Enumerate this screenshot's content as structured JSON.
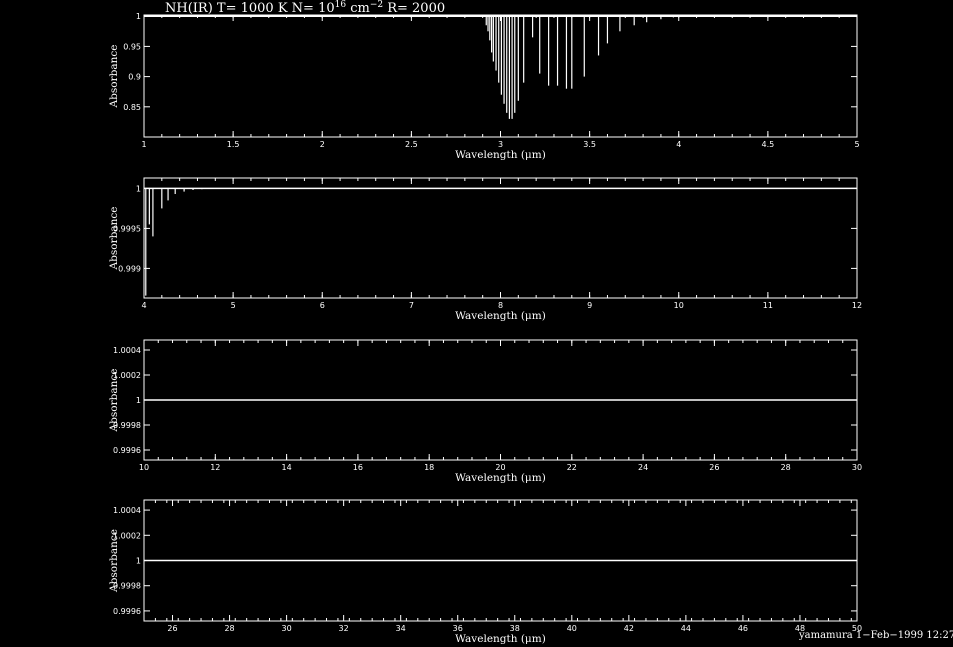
{
  "title": {
    "prefix": "NH(IR) T= 1000 K N= 10",
    "exponent1": "16",
    "middle": " cm",
    "exponent2": "−2",
    "suffix": " R= 2000"
  },
  "credit": "yamamura  1−Feb−1999 12:27",
  "colors": {
    "background": "#000000",
    "foreground": "#ffffff"
  },
  "chart_data": [
    {
      "type": "line",
      "xlabel": "Wavelength (μm)",
      "ylabel": "Absorbance",
      "xlim": [
        1,
        5
      ],
      "ylim": [
        0.8,
        1.002
      ],
      "xticks": [
        1,
        1.5,
        2,
        2.5,
        3,
        3.5,
        4,
        4.5,
        5
      ],
      "xtick_labels": [
        "1",
        "1.5",
        "2",
        "2.5",
        "3",
        "3.5",
        "4",
        "4.5",
        "5"
      ],
      "yticks": [
        0.85,
        0.9,
        0.95,
        1
      ],
      "ytick_labels": [
        "0.85",
        "0.9",
        "0.95",
        "1"
      ],
      "baseline": 1,
      "lines": [
        [
          2.92,
          0.985
        ],
        [
          2.93,
          0.975
        ],
        [
          2.94,
          0.96
        ],
        [
          2.95,
          0.94
        ],
        [
          2.96,
          0.925
        ],
        [
          2.975,
          0.91
        ],
        [
          2.99,
          0.89
        ],
        [
          3.005,
          0.87
        ],
        [
          3.02,
          0.855
        ],
        [
          3.035,
          0.84
        ],
        [
          3.05,
          0.83
        ],
        [
          3.065,
          0.83
        ],
        [
          3.08,
          0.84
        ],
        [
          3.1,
          0.86
        ],
        [
          3.13,
          0.89
        ],
        [
          3.18,
          0.965
        ],
        [
          3.22,
          0.905
        ],
        [
          3.27,
          0.885
        ],
        [
          3.32,
          0.885
        ],
        [
          3.37,
          0.88
        ],
        [
          3.4,
          0.88
        ],
        [
          3.47,
          0.9
        ],
        [
          3.55,
          0.935
        ],
        [
          3.6,
          0.955
        ],
        [
          3.67,
          0.975
        ],
        [
          3.75,
          0.985
        ],
        [
          3.82,
          0.99
        ],
        [
          3.9,
          0.995
        ],
        [
          3.97,
          0.998
        ],
        [
          4.05,
          0.999
        ]
      ],
      "grid": false
    },
    {
      "type": "line",
      "xlabel": "Wavelength (μm)",
      "ylabel": "Absorbance",
      "xlim": [
        4,
        12
      ],
      "ylim": [
        0.99863,
        1.00013
      ],
      "xticks": [
        4,
        5,
        6,
        7,
        8,
        9,
        10,
        11,
        12
      ],
      "xtick_labels": [
        "4",
        "5",
        "6",
        "7",
        "8",
        "9",
        "10",
        "11",
        "12"
      ],
      "yticks": [
        0.999,
        0.9995,
        1
      ],
      "ytick_labels": [
        "0.999",
        "0.9995",
        "1"
      ],
      "baseline": 1,
      "lines": [
        [
          4.02,
          0.99866
        ],
        [
          4.06,
          0.99955
        ],
        [
          4.1,
          0.9994
        ],
        [
          4.2,
          0.99975
        ],
        [
          4.27,
          0.99985
        ],
        [
          4.35,
          0.99993
        ],
        [
          4.45,
          0.99996
        ],
        [
          4.55,
          0.99998
        ],
        [
          4.65,
          0.99999
        ],
        [
          4.75,
          0.999995
        ]
      ],
      "grid": false
    },
    {
      "type": "line",
      "xlabel": "Wavelength (μm)",
      "ylabel": "Absorbance",
      "xlim": [
        10,
        30
      ],
      "ylim": [
        0.99952,
        1.00048
      ],
      "xticks": [
        10,
        12,
        14,
        16,
        18,
        20,
        22,
        24,
        26,
        28,
        30
      ],
      "xtick_labels": [
        "10",
        "12",
        "14",
        "16",
        "18",
        "20",
        "22",
        "24",
        "26",
        "28",
        "30"
      ],
      "yticks": [
        0.9996,
        0.9998,
        1,
        1.0002,
        1.0004
      ],
      "ytick_labels": [
        "0.9996",
        "0.9998",
        "1",
        "1.0002",
        "1.0004"
      ],
      "baseline": 1,
      "lines": [],
      "grid": false
    },
    {
      "type": "line",
      "xlabel": "Wavelength (μm)",
      "ylabel": "Absorbance",
      "xlim": [
        25,
        50
      ],
      "ylim": [
        0.99952,
        1.00048
      ],
      "xticks": [
        26,
        28,
        30,
        32,
        34,
        36,
        38,
        40,
        42,
        44,
        46,
        48,
        50
      ],
      "xtick_labels": [
        "26",
        "28",
        "30",
        "32",
        "34",
        "36",
        "38",
        "40",
        "42",
        "44",
        "46",
        "48",
        "50"
      ],
      "yticks": [
        0.9996,
        0.9998,
        1,
        1.0002,
        1.0004
      ],
      "ytick_labels": [
        "0.9996",
        "0.9998",
        "1",
        "1.0002",
        "1.0004"
      ],
      "baseline": 1,
      "lines": [],
      "grid": false
    }
  ]
}
